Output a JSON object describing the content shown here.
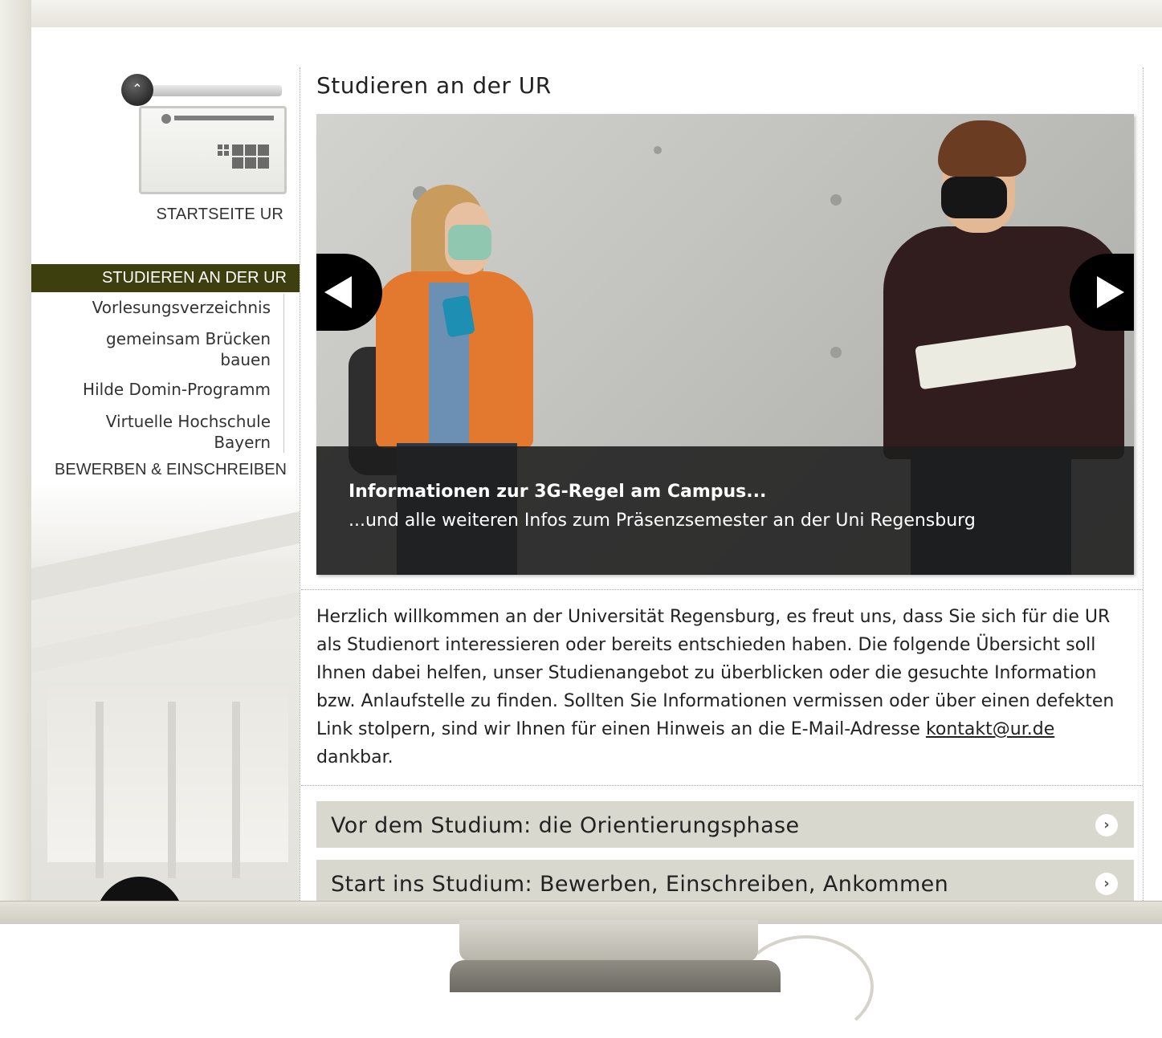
{
  "sidebar": {
    "home_label": "STARTSEITE UR",
    "active_label": "STUDIEREN AN DER UR",
    "sub_items": [
      {
        "label": "Vorlesungsverzeichnis"
      },
      {
        "label": "gemeinsam Brücken bauen"
      },
      {
        "label": "Hilde Domin-Programm"
      },
      {
        "label": "Virtuelle Hochschule Bayern"
      }
    ],
    "bottom_label": "BEWERBEN & EINSCHREIBEN"
  },
  "main": {
    "title": "Studieren an der UR",
    "slide": {
      "title": "Informationen zur 3G-Regel am Campus...",
      "text": "...und alle weiteren Infos zum Präsenzsemester an der Uni Regensburg"
    },
    "intro_before": "Herzlich willkommen an der Universität Regensburg, es freut uns, dass Sie sich für die UR als Studienort interessieren oder bereits entschieden haben. Die folgende Übersicht soll Ihnen dabei helfen, unser Studienangebot zu überblicken oder die gesuchte Information bzw. Anlaufstelle zu finden. Sollten Sie Informationen vermissen oder über einen defekten Link stolpern, sind wir Ihnen für einen Hinweis an die E-Mail-Adresse ",
    "intro_link": "kontakt@ur.de",
    "intro_after": " dankbar.",
    "accordion": [
      {
        "label": "Vor dem Studium: die Orientierungsphase"
      },
      {
        "label": "Start ins Studium: Bewerben, Einschreiben, Ankommen"
      }
    ]
  },
  "colors": {
    "nav_active_bg": "#3d3f0f",
    "accordion_bg": "#d9d8cf"
  },
  "icons": {
    "logo": "ur-logo-icon",
    "prev": "arrow-left-icon",
    "next": "arrow-right-icon",
    "chevron": "chevron-right-icon"
  }
}
